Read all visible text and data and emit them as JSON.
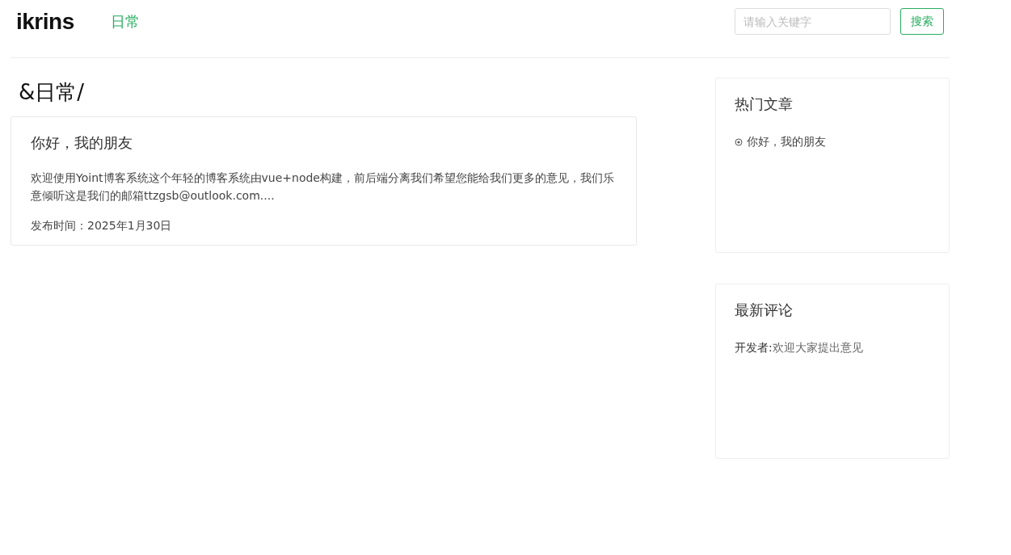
{
  "header": {
    "logo": "ikrins",
    "nav": [
      {
        "label": "日常",
        "selected": true
      }
    ],
    "search": {
      "placeholder": "请输入关键字"
    },
    "search_button": "搜索"
  },
  "category_title": "&日常/",
  "posts": [
    {
      "title": "你好，我的朋友",
      "excerpt": "欢迎使用Yoint博客系统这个年轻的博客系统由vue+node构建，前后端分离我们希望您能给我们更多的意见，我们乐意倾听这是我们的邮箱ttzgsb@outlook.com....",
      "date": "发布时间：2025年1月30日"
    }
  ],
  "hot_articles": {
    "title": "热门文章",
    "items": [
      "你好，我的朋友"
    ]
  },
  "latest_comments": {
    "title": "最新评论",
    "items": [
      {
        "author": "开发者:",
        "text": "欢迎大家提出意见"
      }
    ]
  }
}
